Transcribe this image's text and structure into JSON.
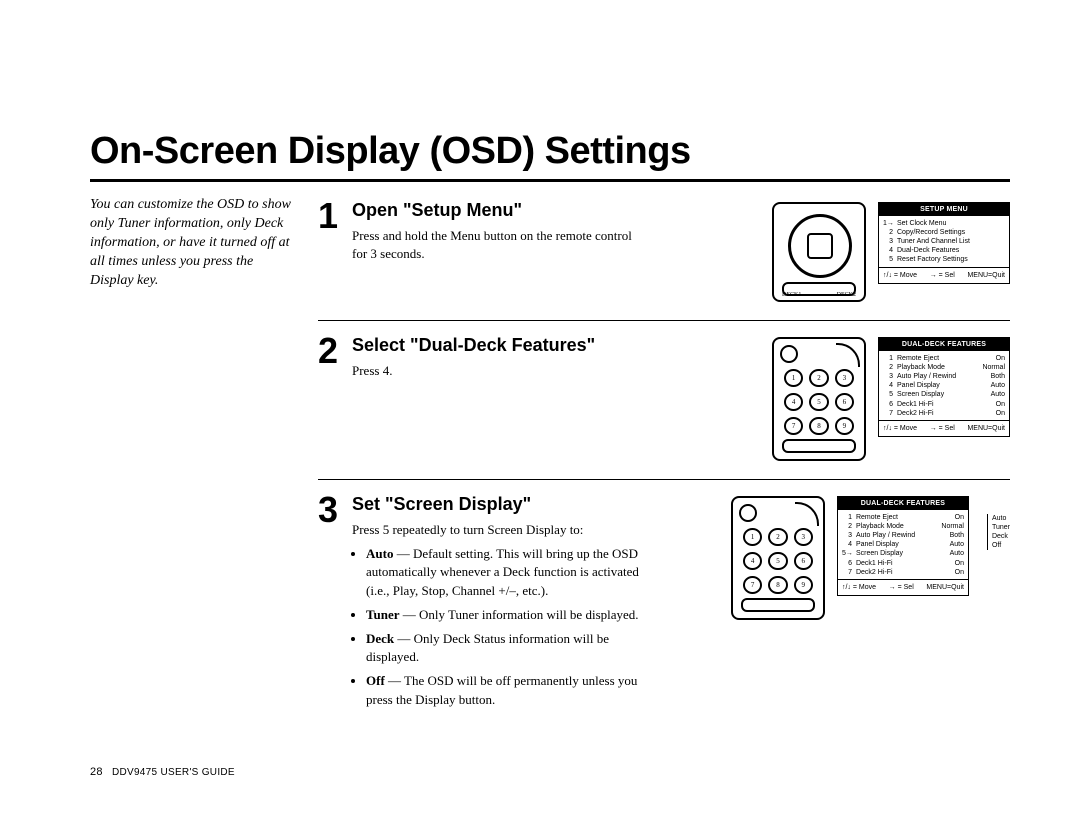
{
  "title": "On-Screen Display (OSD) Settings",
  "sidebar_note": "You can customize the OSD to show only Tuner information, only Deck information, or have it turned off at all times unless you press the Display key.",
  "footer": {
    "page": "28",
    "guide": "DDV9475 USER'S GUIDE"
  },
  "osd_nav": {
    "move": "↑/↓ = Move",
    "sel": "→ = Sel",
    "quit": "MENU=Quit"
  },
  "steps": [
    {
      "num": "1",
      "title": "Open \"Setup Menu\"",
      "body_html": "Press and hold the Menu button on the remote control for 3 seconds.",
      "remote_class": "step1",
      "remote_labels": {
        "left": "DECK1",
        "right": "DECK2"
      },
      "osd": {
        "header": "SETUP MENU",
        "rows": [
          {
            "n": "1→",
            "t": "Set Clock Menu",
            "v": ""
          },
          {
            "n": "2",
            "t": "Copy/Record Settings",
            "v": ""
          },
          {
            "n": "3",
            "t": "Tuner And Channel List",
            "v": ""
          },
          {
            "n": "4",
            "t": "Dual-Deck Features",
            "v": ""
          },
          {
            "n": "5",
            "t": "Reset Factory Settings",
            "v": ""
          }
        ]
      }
    },
    {
      "num": "2",
      "title": "Select \"Dual-Deck Features\"",
      "body_html": "Press 4.",
      "osd": {
        "header": "DUAL-DECK FEATURES",
        "rows": [
          {
            "n": "1",
            "t": "Remote Eject",
            "v": "On"
          },
          {
            "n": "2",
            "t": "Playback Mode",
            "v": "Normal"
          },
          {
            "n": "3",
            "t": "Auto Play / Rewind",
            "v": "Both"
          },
          {
            "n": "4",
            "t": "Panel Display",
            "v": "Auto"
          },
          {
            "n": "5",
            "t": "Screen Display",
            "v": "Auto"
          },
          {
            "n": "6",
            "t": "Deck1 Hi-Fi",
            "v": "On"
          },
          {
            "n": "7",
            "t": "Deck2 Hi-Fi",
            "v": "On"
          }
        ]
      }
    },
    {
      "num": "3",
      "title": "Set \"Screen Display\"",
      "body_html": "Press 5 repeatedly to turn Screen Display to:",
      "bullets": [
        {
          "term": "Auto",
          "desc": " — Default setting. This will bring up the OSD automatically whenever a Deck function is activated (i.e., Play, Stop, Channel +/–, etc.)."
        },
        {
          "term": "Tuner",
          "desc": " — Only Tuner information will be displayed."
        },
        {
          "term": "Deck",
          "desc": " — Only Deck Status information will be displayed."
        },
        {
          "term": "Off",
          "desc": " — The OSD will be off permanently unless you press the Display button."
        }
      ],
      "osd": {
        "header": "DUAL-DECK FEATURES",
        "rows": [
          {
            "n": "1",
            "t": "Remote Eject",
            "v": "On"
          },
          {
            "n": "2",
            "t": "Playback Mode",
            "v": "Normal"
          },
          {
            "n": "3",
            "t": "Auto Play / Rewind",
            "v": "Both"
          },
          {
            "n": "4",
            "t": "Panel Display",
            "v": "Auto"
          },
          {
            "n": "5→",
            "t": "Screen Display",
            "v": "Auto"
          },
          {
            "n": "6",
            "t": "Deck1 Hi-Fi",
            "v": "On"
          },
          {
            "n": "7",
            "t": "Deck2 Hi-Fi",
            "v": "On"
          }
        ]
      },
      "sidepanel": [
        "Auto",
        "Tuner",
        "Deck",
        "Off"
      ]
    }
  ]
}
